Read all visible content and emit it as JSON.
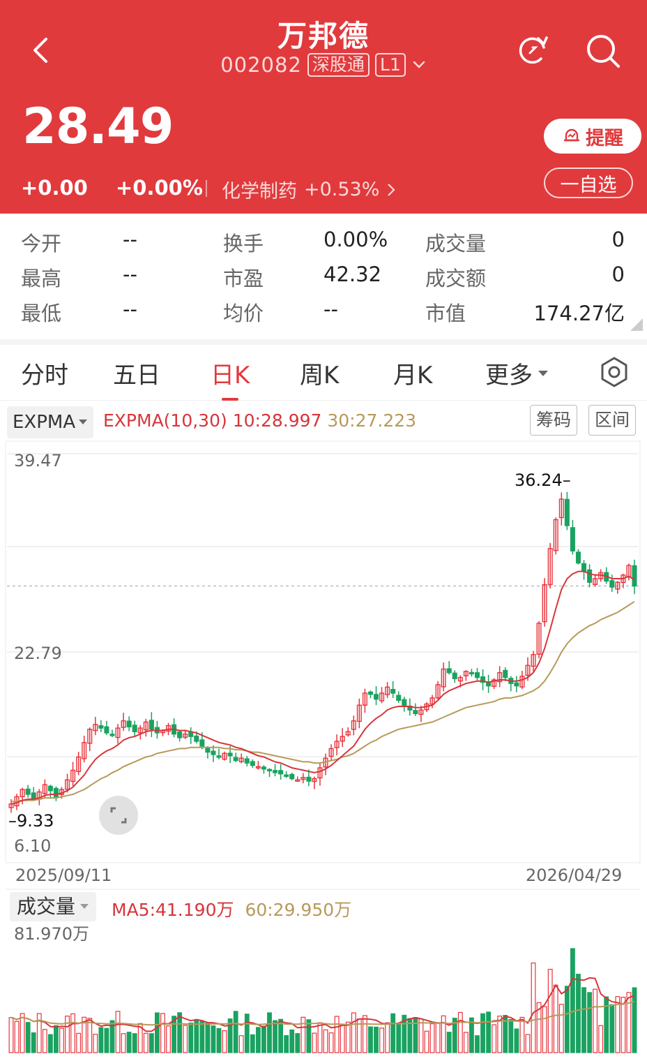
{
  "header": {
    "title": "万邦德",
    "code": "002082",
    "tag1": "深股通",
    "tag2": "L1",
    "price": "28.49",
    "change": "+0.00",
    "change_pct": "+0.00%",
    "sector": "化学制药",
    "sector_pct": "+0.53%",
    "remind_label": "提醒",
    "watch_label": "一自选"
  },
  "stats": [
    {
      "label": "今开",
      "value": "--"
    },
    {
      "label": "换手",
      "value": "0.00%"
    },
    {
      "label": "成交量",
      "value": "0"
    },
    {
      "label": "最高",
      "value": "--"
    },
    {
      "label": "市盈",
      "value": "42.32"
    },
    {
      "label": "成交额",
      "value": "0"
    },
    {
      "label": "最低",
      "value": "--"
    },
    {
      "label": "均价",
      "value": "--"
    },
    {
      "label": "市值",
      "value": "174.27亿"
    }
  ],
  "tabs": [
    "分时",
    "五日",
    "日K",
    "周K",
    "月K",
    "更多"
  ],
  "indicator": {
    "selector": "EXPMA",
    "label": "EXPMA(10,30)",
    "e10": "10:28.997",
    "e30": "30:27.223",
    "btn_chips": "筹码",
    "btn_range": "区间"
  },
  "colors": {
    "up": "#e8333b",
    "down": "#1aa260",
    "ema10": "#d6353a",
    "ema30": "#b79a5a",
    "brand": "#e13a3d"
  },
  "chart": {
    "y_top": "39.47",
    "y_mid": "22.79",
    "y_bottom": "6.10",
    "high_label": "36.24",
    "low_label": "9.33",
    "date_start": "2025/09/11",
    "date_end": "2026/04/29"
  },
  "volume": {
    "selector": "成交量",
    "ma5": "MA5:41.190万",
    "ma60": "60:29.950万",
    "max": "81.970万"
  },
  "chart_data": {
    "type": "candlestick",
    "ylim": [
      6.1,
      39.47
    ],
    "closes": [
      10.4,
      11.0,
      11.6,
      11.2,
      10.8,
      11.4,
      12.0,
      11.5,
      11.0,
      11.6,
      12.4,
      13.2,
      14.3,
      15.5,
      16.6,
      17.0,
      16.7,
      16.3,
      16.1,
      16.7,
      17.3,
      16.8,
      16.4,
      16.7,
      17.2,
      16.6,
      16.3,
      16.5,
      16.9,
      16.2,
      15.9,
      16.2,
      16.0,
      15.6,
      15.2,
      14.7,
      14.5,
      14.3,
      14.6,
      14.4,
      14.0,
      14.2,
      13.8,
      13.6,
      13.5,
      13.3,
      13.2,
      13.0,
      12.9,
      12.7,
      12.5,
      12.4,
      12.6,
      12.3,
      12.5,
      13.4,
      14.2,
      15.0,
      15.6,
      16.0,
      16.4,
      17.3,
      18.6,
      19.6,
      19.5,
      19.1,
      19.6,
      20.1,
      19.6,
      19.0,
      18.6,
      18.2,
      17.9,
      18.2,
      18.7,
      19.2,
      20.3,
      21.6,
      21.3,
      20.8,
      20.9,
      21.4,
      21.2,
      20.9,
      20.5,
      20.2,
      20.7,
      21.3,
      20.9,
      20.4,
      20.2,
      21.0,
      21.9,
      22.8,
      25.4,
      28.6,
      31.6,
      34.0,
      35.7,
      33.5,
      31.4,
      30.4,
      29.7,
      28.8,
      29.1,
      29.6,
      28.9,
      28.4,
      28.8,
      29.4,
      30.2,
      28.49
    ],
    "ema10": [
      10.4,
      10.5,
      10.7,
      10.8,
      10.8,
      10.9,
      11.1,
      11.2,
      11.2,
      11.3,
      11.5,
      11.8,
      12.3,
      12.8,
      13.5,
      14.1,
      14.5,
      14.8,
      15.0,
      15.3,
      15.7,
      15.9,
      16.0,
      16.2,
      16.4,
      16.5,
      16.5,
      16.5,
      16.6,
      16.6,
      16.5,
      16.5,
      16.4,
      16.3,
      16.1,
      15.9,
      15.7,
      15.5,
      15.4,
      15.3,
      15.1,
      15.0,
      14.8,
      14.6,
      14.4,
      14.3,
      14.1,
      13.9,
      13.8,
      13.6,
      13.4,
      13.3,
      13.2,
      13.1,
      13.0,
      13.1,
      13.3,
      13.6,
      14.0,
      14.4,
      14.8,
      15.2,
      15.9,
      16.6,
      17.1,
      17.5,
      17.8,
      18.2,
      18.4,
      18.5,
      18.5,
      18.5,
      18.4,
      18.4,
      18.5,
      18.6,
      19.0,
      19.5,
      19.8,
      20.0,
      20.2,
      20.4,
      20.5,
      20.6,
      20.6,
      20.5,
      20.6,
      20.7,
      20.7,
      20.6,
      20.6,
      20.7,
      20.9,
      21.3,
      22.1,
      23.3,
      24.9,
      26.6,
      28.2,
      29.1,
      29.5,
      29.7,
      29.7,
      29.5,
      29.4,
      29.4,
      29.3,
      29.1,
      29.1,
      29.1,
      29.3,
      29.0
    ],
    "ema30": [
      10.6,
      10.6,
      10.7,
      10.7,
      10.7,
      10.8,
      10.9,
      10.9,
      10.9,
      11.0,
      11.1,
      11.2,
      11.4,
      11.6,
      11.9,
      12.2,
      12.5,
      12.7,
      13.0,
      13.2,
      13.5,
      13.7,
      13.9,
      14.1,
      14.3,
      14.4,
      14.6,
      14.7,
      14.8,
      14.9,
      15.0,
      15.0,
      15.1,
      15.1,
      15.1,
      15.1,
      15.1,
      15.1,
      15.0,
      15.0,
      14.9,
      14.9,
      14.8,
      14.7,
      14.7,
      14.6,
      14.5,
      14.4,
      14.3,
      14.2,
      14.1,
      14.0,
      13.9,
      13.9,
      13.8,
      13.8,
      13.9,
      14.0,
      14.1,
      14.3,
      14.4,
      14.6,
      14.9,
      15.2,
      15.5,
      15.7,
      16.0,
      16.2,
      16.4,
      16.6,
      16.7,
      16.8,
      16.9,
      17.0,
      17.1,
      17.2,
      17.4,
      17.6,
      17.8,
      18.0,
      18.2,
      18.4,
      18.5,
      18.6,
      18.7,
      18.8,
      18.9,
      19.1,
      19.2,
      19.2,
      19.3,
      19.4,
      19.6,
      19.8,
      20.1,
      20.6,
      21.3,
      22.1,
      23.0,
      23.7,
      24.2,
      24.6,
      24.9,
      25.2,
      25.4,
      25.7,
      25.9,
      26.1,
      26.3,
      26.6,
      26.9,
      27.2
    ]
  }
}
